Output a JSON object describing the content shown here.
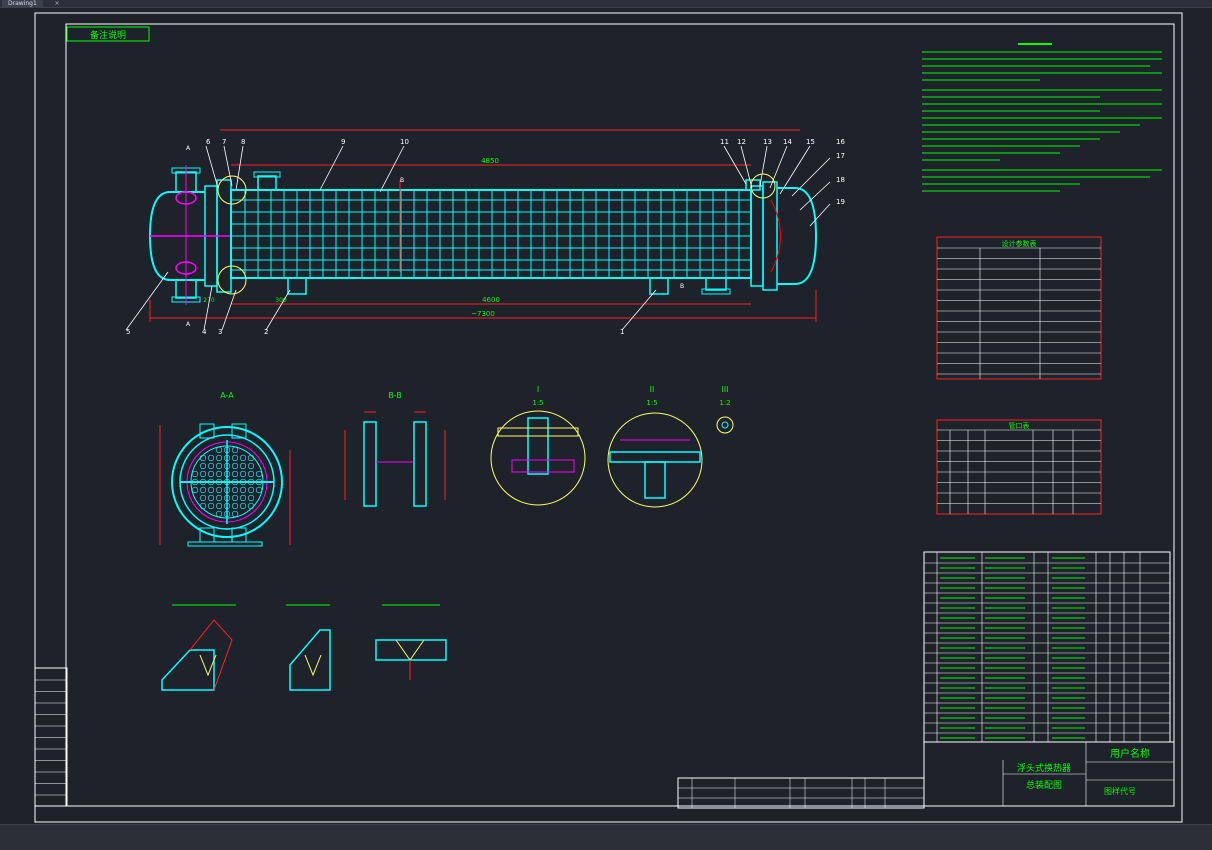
{
  "tab": {
    "title": "Drawing1"
  },
  "drawing": {
    "stamp": "备注说明",
    "section_labels": [
      "A-A",
      "B-B",
      "I",
      "II",
      "III"
    ],
    "scales": [
      "1:5",
      "1:5",
      "1:2"
    ],
    "part_numbers": [
      "1",
      "2",
      "3",
      "4",
      "5",
      "6",
      "7",
      "8",
      "9",
      "10",
      "11",
      "12",
      "13",
      "14",
      "15",
      "16",
      "17",
      "18",
      "19"
    ],
    "design_table_title": "设计参数表",
    "nozzle_table_title": "管口表",
    "dimensions": {
      "overall": "~7300",
      "middle": "4600",
      "left_small": "270",
      "left_mid": "300",
      "right_top": "4850"
    },
    "title_block": {
      "row1": "浮头式换热器",
      "row2": "总装配图",
      "row3": "图样代号",
      "row4": "用户名称"
    }
  },
  "colors": {
    "frame": "#ffffff",
    "primary": "#00ffff",
    "accent": "#ff00ff",
    "dim": "#ff2020",
    "text": "#00ff00",
    "grid": "#ffff66",
    "bg": "#1d222b"
  }
}
